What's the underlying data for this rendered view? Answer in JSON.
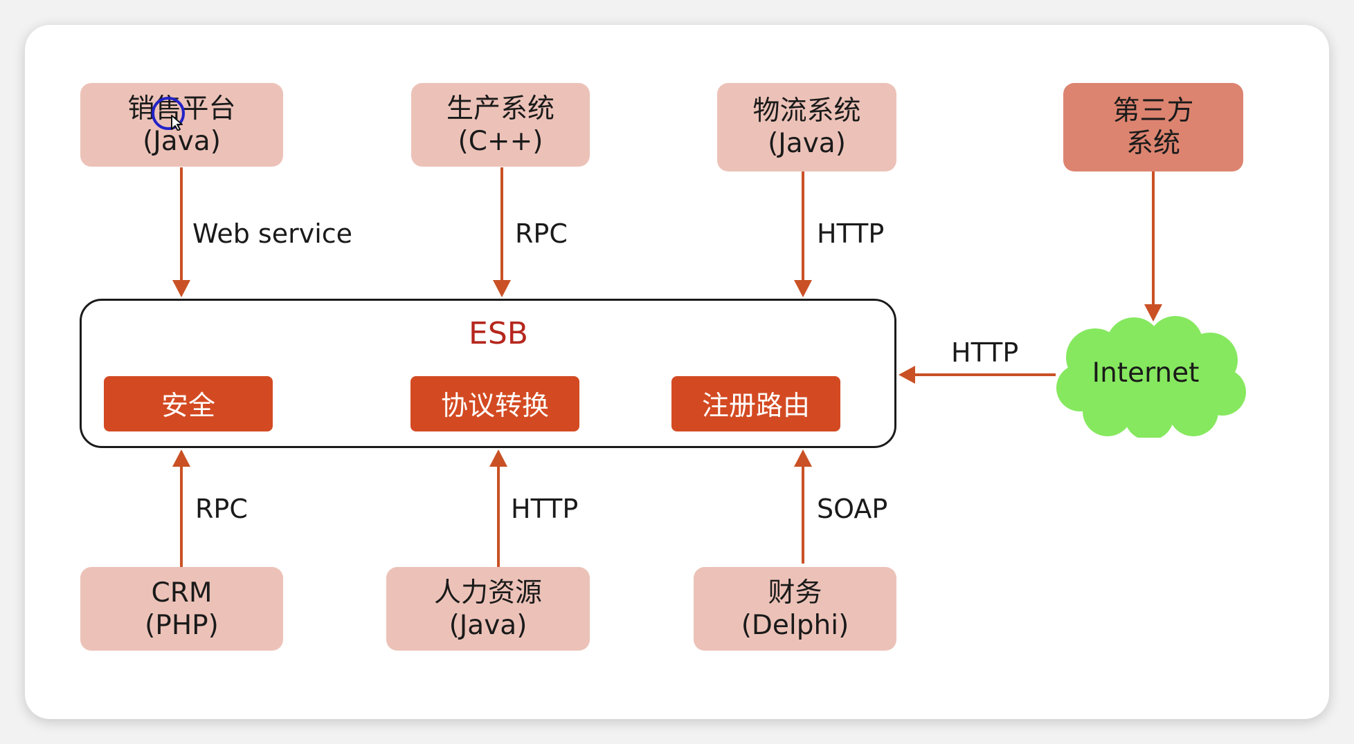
{
  "colors": {
    "node_light": "#ecc2b8",
    "node_dark": "#dc8470",
    "arrow": "#c95125",
    "esb_title": "#b5271d",
    "module": "#d34a22",
    "cloud": "#86e85f"
  },
  "systems_top": [
    {
      "name": "销售平台",
      "tech": "(Java)"
    },
    {
      "name": "生产系统",
      "tech": "(C++)"
    },
    {
      "name": "物流系统",
      "tech": "(Java)"
    },
    {
      "name": "第三方",
      "tech": "系统"
    }
  ],
  "systems_bottom": [
    {
      "name": "CRM",
      "tech": "(PHP)"
    },
    {
      "name": "人力资源",
      "tech": "(Java)"
    },
    {
      "name": "财务",
      "tech": "(Delphi)"
    }
  ],
  "esb": {
    "title": "ESB",
    "modules": [
      "安全",
      "协议转换",
      "注册路由"
    ]
  },
  "protocols_top": [
    "Web service",
    "RPC",
    "HTTP"
  ],
  "protocols_bottom": [
    "RPC",
    "HTTP",
    "SOAP"
  ],
  "internet": {
    "label": "Internet",
    "link_protocol": "HTTP"
  },
  "icons": {
    "pointer": "mouse-cursor-icon"
  }
}
